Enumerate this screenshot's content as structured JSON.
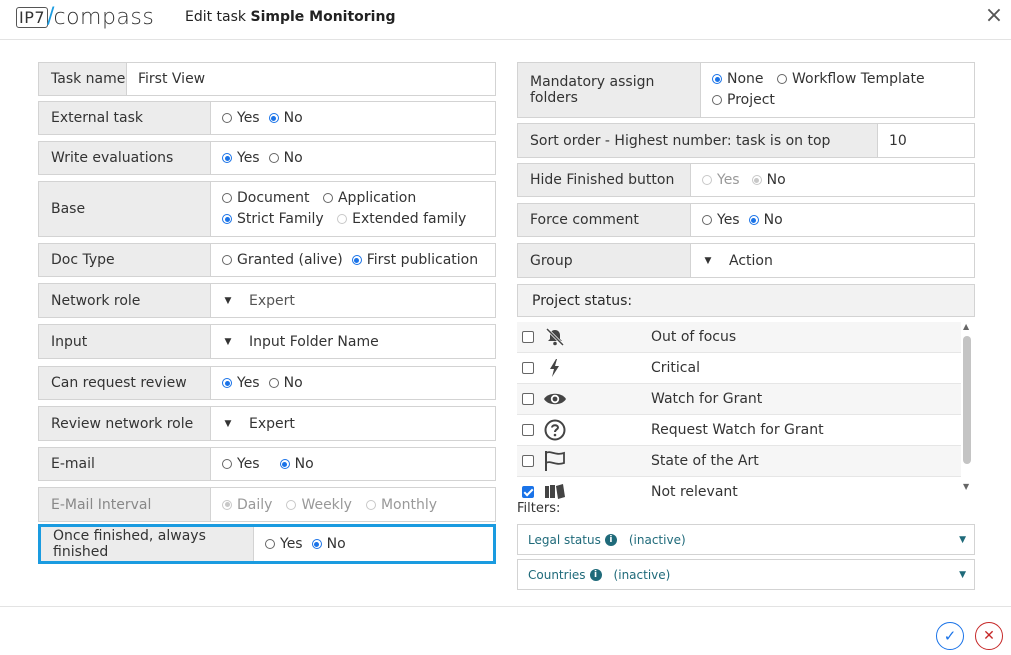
{
  "header": {
    "logo_left": "IP7",
    "logo_right": "compass",
    "title_prefix": "Edit task",
    "title_name": "Simple Monitoring"
  },
  "left": {
    "task_name": {
      "label": "Task name",
      "value": "First View"
    },
    "external_task": {
      "label": "External task",
      "opt1": "Yes",
      "opt2": "No",
      "selected": "No"
    },
    "write_evaluations": {
      "label": "Write evaluations",
      "opt1": "Yes",
      "opt2": "No",
      "selected": "Yes"
    },
    "base": {
      "label": "Base",
      "opt1": "Document",
      "opt2": "Application",
      "opt3": "Strict Family",
      "opt4": "Extended family",
      "selected": "Strict Family"
    },
    "doc_type": {
      "label": "Doc Type",
      "opt1": "Granted (alive)",
      "opt2": "First publication",
      "selected": "First publication"
    },
    "network_role": {
      "label": "Network role",
      "value": "Expert"
    },
    "input": {
      "label": "Input",
      "value": "Input Folder Name"
    },
    "can_request_review": {
      "label": "Can request review",
      "opt1": "Yes",
      "opt2": "No",
      "selected": "Yes"
    },
    "review_network_role": {
      "label": "Review network role",
      "value": "Expert"
    },
    "email": {
      "label": "E-mail",
      "opt1": "Yes",
      "opt2": "No",
      "selected": "No"
    },
    "email_interval": {
      "label": "E-Mail Interval",
      "opt1": "Daily",
      "opt2": "Weekly",
      "opt3": "Monthly",
      "selected": "Daily"
    },
    "once_finished": {
      "label": "Once finished, always finished",
      "opt1": "Yes",
      "opt2": "No",
      "selected": "No"
    }
  },
  "right": {
    "mandatory_folders": {
      "label": "Mandatory assign folders",
      "opt1": "None",
      "opt2": "Workflow Template",
      "opt3": "Project",
      "selected": "None"
    },
    "sort_order": {
      "label": "Sort order - Highest number: task is on top",
      "value": "10"
    },
    "hide_finished": {
      "label": "Hide Finished button",
      "opt1": "Yes",
      "opt2": "No",
      "selected": "No"
    },
    "force_comment": {
      "label": "Force comment",
      "opt1": "Yes",
      "opt2": "No",
      "selected": "No"
    },
    "group": {
      "label": "Group",
      "value": "Action"
    },
    "project_status": {
      "label": "Project status:",
      "items": [
        {
          "label": "Out of focus",
          "icon": "bell-off-icon",
          "checked": false
        },
        {
          "label": "Critical",
          "icon": "lightning-icon",
          "checked": false
        },
        {
          "label": "Watch for Grant",
          "icon": "eye-icon",
          "checked": false
        },
        {
          "label": "Request Watch for Grant",
          "icon": "question-circle-icon",
          "checked": false
        },
        {
          "label": "State of the Art",
          "icon": "flag-icon",
          "checked": false
        },
        {
          "label": "Not relevant",
          "icon": "book-icon",
          "checked": true
        }
      ]
    },
    "filters": {
      "label": "Filters:",
      "legal_status": {
        "label": "Legal status",
        "status": "(inactive)"
      },
      "countries": {
        "label": "Countries",
        "status": "(inactive)"
      }
    }
  },
  "footer": {
    "ok": "✓",
    "cancel": "✕"
  },
  "colors": {
    "accent": "#1a9be0",
    "primary": "#1a73e8",
    "danger": "#c62828",
    "label_bg": "#ececec"
  }
}
